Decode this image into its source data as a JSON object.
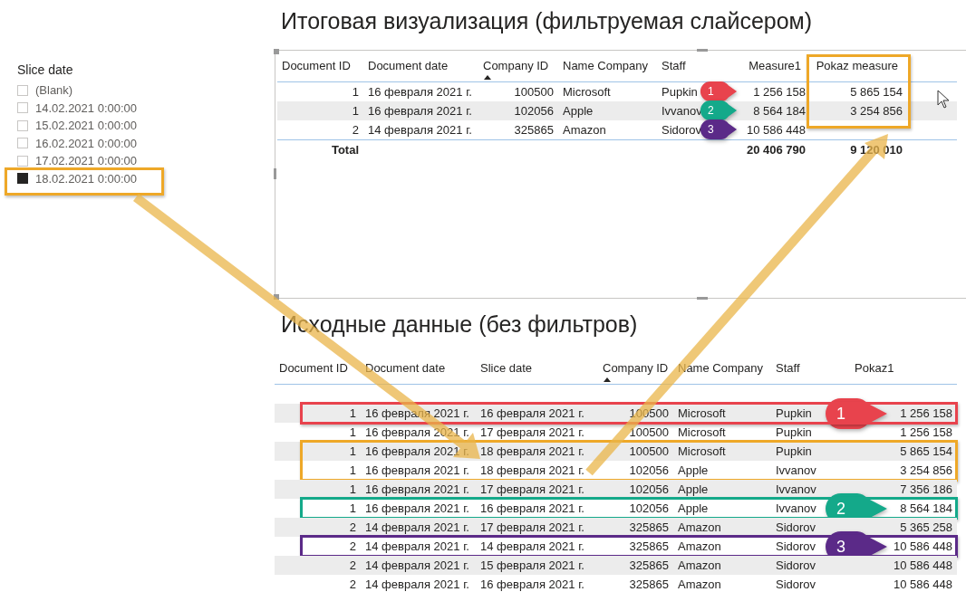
{
  "slicer": {
    "title": "Slice date",
    "items": [
      {
        "label": "(Blank)",
        "checked": false,
        "framed": false
      },
      {
        "label": "14.02.2021 0:00:00",
        "checked": false,
        "framed": false
      },
      {
        "label": "15.02.2021 0:00:00",
        "checked": false,
        "framed": false
      },
      {
        "label": "16.02.2021 0:00:00",
        "checked": false,
        "framed": false
      },
      {
        "label": "17.02.2021 0:00:00",
        "checked": false,
        "framed": false
      },
      {
        "label": "18.02.2021 0:00:00",
        "checked": true,
        "framed": true
      }
    ]
  },
  "result_title": "Итоговая визуализация (фильтруемая слайсером)",
  "result_table": {
    "columns": [
      {
        "label": "Document ID",
        "sorted": false,
        "framed": false
      },
      {
        "label": "Document date",
        "sorted": false,
        "framed": false
      },
      {
        "label": "Company ID",
        "sorted": true,
        "framed": false
      },
      {
        "label": "Name Company",
        "sorted": false,
        "framed": false
      },
      {
        "label": "Staff",
        "sorted": false,
        "framed": false
      },
      {
        "label": "Measure1",
        "sorted": false,
        "framed": false
      },
      {
        "label": "Pokaz measure",
        "sorted": false,
        "framed": true
      }
    ],
    "rows": [
      {
        "cells": [
          "1",
          "16 февраля 2021 г.",
          "100500",
          "Microsoft",
          "Pupkin",
          "1 256 158",
          "5 865 154"
        ],
        "in_frame": true,
        "marker": {
          "label": "1",
          "color": "#e8434d"
        }
      },
      {
        "cells": [
          "1",
          "16 февраля 2021 г.",
          "102056",
          "Apple",
          "Ivvanov",
          "8 564 184",
          "3 254 856"
        ],
        "in_frame": true,
        "marker": {
          "label": "2",
          "color": "#14a98a"
        }
      },
      {
        "cells": [
          "2",
          "14 февраля 2021 г.",
          "325865",
          "Amazon",
          "Sidorov",
          "10 586 448"
        ],
        "in_frame": false,
        "marker": {
          "label": "3",
          "color": "#5b2a88"
        }
      }
    ],
    "total": {
      "label": "Total",
      "measure1": "20 406 790",
      "pokaz_measure": "9 120 010"
    }
  },
  "source_title": "Исходные данные (без фильтров)",
  "source_table": {
    "columns": [
      {
        "label": "Document ID",
        "sorted": false
      },
      {
        "label": "Document date",
        "sorted": false
      },
      {
        "label": "Slice date",
        "sorted": false
      },
      {
        "label": "Company ID",
        "sorted": true
      },
      {
        "label": "Name Company",
        "sorted": false
      },
      {
        "label": "Staff",
        "sorted": false
      },
      {
        "label": "Pokaz1",
        "sorted": false
      }
    ],
    "row_groups": [
      {
        "color": "#e8434d",
        "rows": [
          {
            "cells": [
              "1",
              "16 февраля 2021 г.",
              "16 февраля 2021 г.",
              "100500",
              "Microsoft",
              "Pupkin",
              "1 256 158"
            ],
            "marker": {
              "label": "1",
              "color": "#e8434d"
            }
          }
        ]
      },
      {
        "rows": [
          {
            "cells": [
              "1",
              "16 февраля 2021 г.",
              "17 февраля 2021 г.",
              "100500",
              "Microsoft",
              "Pupkin",
              "1 256 158"
            ]
          }
        ]
      },
      {
        "color": "#eea828",
        "rows": [
          {
            "cells": [
              "1",
              "16 февраля 2021 г.",
              "18 февраля 2021 г.",
              "100500",
              "Microsoft",
              "Pupkin",
              "5 865 154"
            ]
          },
          {
            "cells": [
              "1",
              "16 февраля 2021 г.",
              "18 февраля 2021 г.",
              "102056",
              "Apple",
              "Ivvanov",
              "3 254 856"
            ]
          }
        ]
      },
      {
        "rows": [
          {
            "cells": [
              "1",
              "16 февраля 2021 г.",
              "17 февраля 2021 г.",
              "102056",
              "Apple",
              "Ivvanov",
              "7 356 186"
            ]
          }
        ]
      },
      {
        "color": "#14a98a",
        "rows": [
          {
            "cells": [
              "1",
              "16 февраля 2021 г.",
              "16 февраля 2021 г.",
              "102056",
              "Apple",
              "Ivvanov",
              "8 564 184"
            ],
            "marker": {
              "label": "2",
              "color": "#14a98a"
            }
          }
        ]
      },
      {
        "rows": [
          {
            "cells": [
              "2",
              "14 февраля 2021 г.",
              "17 февраля 2021 г.",
              "325865",
              "Amazon",
              "Sidorov",
              "5 365 258"
            ]
          }
        ]
      },
      {
        "color": "#5b2a88",
        "rows": [
          {
            "cells": [
              "2",
              "14 февраля 2021 г.",
              "14 февраля 2021 г.",
              "325865",
              "Amazon",
              "Sidorov",
              "10 586 448"
            ],
            "marker": {
              "label": "3",
              "color": "#5b2a88"
            }
          }
        ]
      },
      {
        "rows": [
          {
            "cells": [
              "2",
              "14 февраля 2021 г.",
              "15 февраля 2021 г.",
              "325865",
              "Amazon",
              "Sidorov",
              "10 586 448"
            ]
          },
          {
            "cells": [
              "2",
              "14 февраля 2021 г.",
              "16 февраля 2021 г.",
              "325865",
              "Amazon",
              "Sidorov",
              "10 586 448"
            ]
          }
        ]
      }
    ]
  }
}
